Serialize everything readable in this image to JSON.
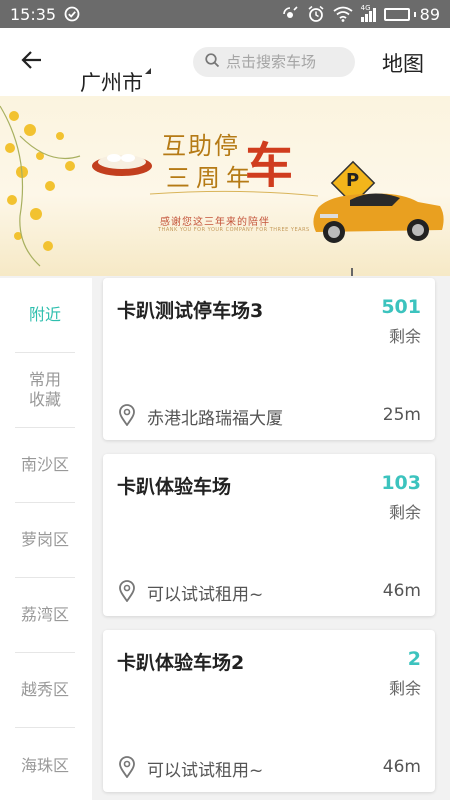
{
  "status_bar": {
    "time": "15:35",
    "signal_label": "4G",
    "battery": "89",
    "battery_level": 0.89
  },
  "header": {
    "back_icon": "arrow-left-icon",
    "city": "广州市",
    "search_placeholder": "点击搜索车场",
    "map_label": "地图"
  },
  "banner": {
    "title_line1": "互助停",
    "title_big": "车",
    "title_line2": "三周年",
    "subtitle": "感谢您这三年来的陪伴",
    "subtitle_en": "THANK YOU FOR YOUR COMPANY FOR THREE YEARS",
    "parking_sign": "P",
    "accent_color": "#b57a15"
  },
  "side_nav": {
    "items": [
      {
        "label": "附近",
        "active": true
      },
      {
        "label": "常用收藏",
        "active": false
      },
      {
        "label": "南沙区",
        "active": false
      },
      {
        "label": "萝岗区",
        "active": false
      },
      {
        "label": "荔湾区",
        "active": false
      },
      {
        "label": "越秀区",
        "active": false
      },
      {
        "label": "海珠区",
        "active": false
      }
    ],
    "active_color": "#2fbfae"
  },
  "lots": [
    {
      "name": "卡趴测试停车场3",
      "count": "501",
      "count_label": "剩余",
      "address": "赤港北路瑞福大厦",
      "distance": "25m"
    },
    {
      "name": "卡趴体验车场",
      "count": "103",
      "count_label": "剩余",
      "address": "可以试试租用~",
      "distance": "46m"
    },
    {
      "name": "卡趴体验车场2",
      "count": "2",
      "count_label": "剩余",
      "address": "可以试试租用~",
      "distance": "46m"
    }
  ]
}
